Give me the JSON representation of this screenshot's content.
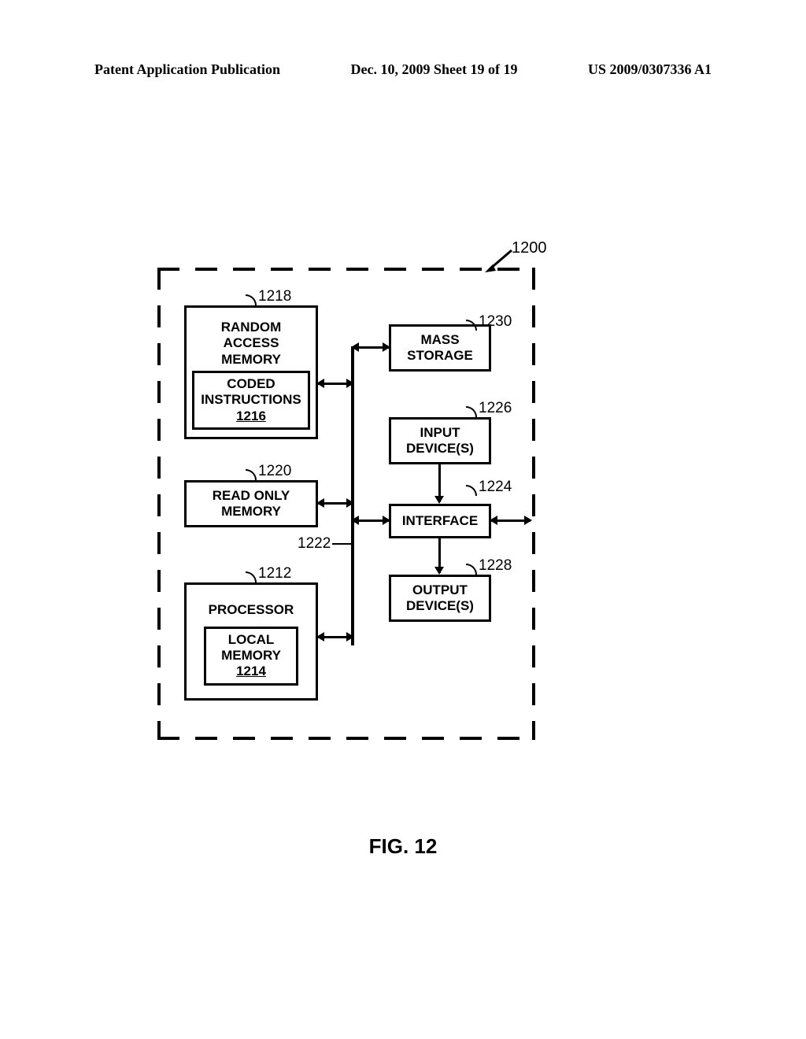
{
  "header": {
    "left": "Patent Application Publication",
    "center": "Dec. 10, 2009  Sheet 19 of 19",
    "right": "US 2009/0307336 A1"
  },
  "refs": {
    "system": "1200",
    "ram": "1218",
    "coded": "1216",
    "rom": "1220",
    "bus": "1222",
    "proc": "1212",
    "local": "1214",
    "mass": "1230",
    "input": "1226",
    "iface": "1224",
    "output": "1228"
  },
  "labels": {
    "ram1": "RANDOM",
    "ram2": "ACCESS",
    "ram3": "MEMORY",
    "coded1": "CODED",
    "coded2": "INSTRUCTIONS",
    "rom1": "READ ONLY",
    "rom2": "MEMORY",
    "proc": "PROCESSOR",
    "local1": "LOCAL",
    "local2": "MEMORY",
    "mass1": "MASS",
    "mass2": "STORAGE",
    "input1": "INPUT",
    "input2": "DEVICE(S)",
    "iface": "INTERFACE",
    "output1": "OUTPUT",
    "output2": "DEVICE(S)"
  },
  "figure_caption": "FIG. 12"
}
